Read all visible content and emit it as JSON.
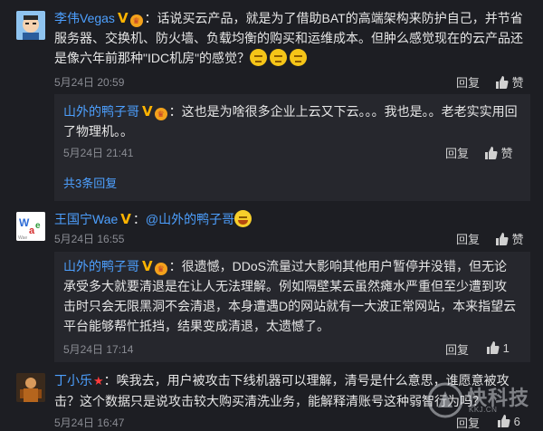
{
  "comments": [
    {
      "user": "李伟Vegas",
      "text": "话说买云产品，就是为了借助BAT的高端架构来防护自己，并节省服务器、交换机、防火墙、负载均衡的购买和运维成本。但肿么感觉现在的云产品还是像六年前那种\"IDC机房\"的感觉？",
      "time": "5月24日 20:59",
      "reply_label": "回复",
      "like_label": "赞",
      "replies": [
        {
          "user": "山外的鸭子哥",
          "text": "这也是为啥很多企业上云又下云。。。我也是。。老老实实用回了物理机。。",
          "time": "5月24日 21:41",
          "reply_label": "回复",
          "like_label": "赞"
        }
      ],
      "more_replies": "共3条回复"
    },
    {
      "user": "王国宁Wae",
      "mention": "@山外的鸭子哥",
      "time": "5月24日 16:55",
      "reply_label": "回复",
      "like_label": "赞",
      "replies": [
        {
          "user": "山外的鸭子哥",
          "text": "很遗憾，DDoS流量过大影响其他用户暂停并没错，但无论承受多大就要清退是在让人无法理解。例如隔壁某云虽然瘫水严重但至少遭到攻击时只会无限黑洞不会清退，本身遭遇D的网站就有一大波正常网站，本来指望云平台能够帮忙抵挡，结果变成清退，太遗憾了。",
          "time": "5月24日 17:14",
          "reply_label": "回复",
          "like_count": "1"
        }
      ]
    },
    {
      "user": "丁小乐",
      "text": "唉我去，用户被攻击下线机器可以理解，清号是什么意思，谁愿意被攻击？这个数据只是说攻击较大购买清洗业务，能解释清账号这种弱智行为吗？",
      "time": "5月24日 16:47",
      "reply_label": "回复",
      "like_count": "6"
    }
  ],
  "watermark": {
    "text": "快科技",
    "sub": "KKJ.CN"
  },
  "colors": {
    "background": "#1d1e23",
    "reply_background": "#26272d",
    "link": "#4da0ff",
    "meta": "#8a8c93",
    "vip": "#ffb400"
  }
}
